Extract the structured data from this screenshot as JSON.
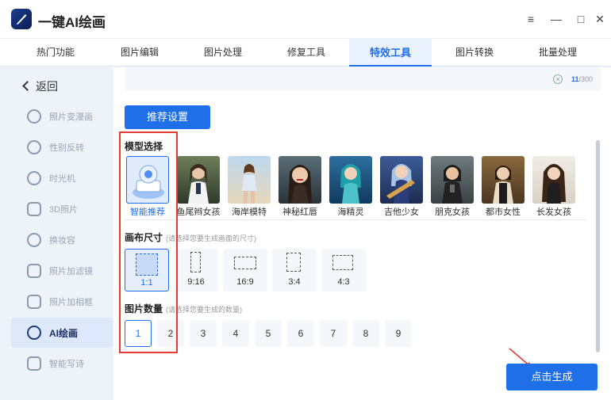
{
  "app": {
    "title": "一键AI绘画"
  },
  "window_controls": {
    "menu": "≡",
    "minimize": "—",
    "maximize": "□",
    "close": "✕"
  },
  "tabs": [
    {
      "label": "热门功能",
      "active": false
    },
    {
      "label": "图片编辑",
      "active": false
    },
    {
      "label": "图片处理",
      "active": false
    },
    {
      "label": "修复工具",
      "active": false
    },
    {
      "label": "特效工具",
      "active": true
    },
    {
      "label": "图片转换",
      "active": false
    },
    {
      "label": "批量处理",
      "active": false
    }
  ],
  "sidebar": {
    "back_label": "返回",
    "items": [
      {
        "label": "照片变漫画",
        "icon": "cartoon-face-icon"
      },
      {
        "label": "性别反转",
        "icon": "gender-icon"
      },
      {
        "label": "时光机",
        "icon": "clock-icon"
      },
      {
        "label": "3D照片",
        "icon": "layers-icon"
      },
      {
        "label": "换妆容",
        "icon": "makeup-icon"
      },
      {
        "label": "照片加滤镜",
        "icon": "filter-icon"
      },
      {
        "label": "照片加相框",
        "icon": "frame-icon"
      },
      {
        "label": "AI绘画",
        "icon": "ai-paint-icon",
        "active": true
      },
      {
        "label": "智能写诗",
        "icon": "ai-poem-icon"
      }
    ]
  },
  "prompt": {
    "counter_current": "11",
    "counter_max": "/300"
  },
  "recommend_button": "推荐设置",
  "model_section": {
    "title": "模型选择",
    "models": [
      {
        "label": "智能推荐",
        "active": true
      },
      {
        "label": "鱼尾辫女孩"
      },
      {
        "label": "海岸模特"
      },
      {
        "label": "神秘红唇"
      },
      {
        "label": "海精灵"
      },
      {
        "label": "吉他少女"
      },
      {
        "label": "朋克女孩"
      },
      {
        "label": "都市女性"
      },
      {
        "label": "长发女孩"
      }
    ]
  },
  "canvas_section": {
    "title": "画布尺寸",
    "hint": "(请选择您要生成画面的尺寸)",
    "ratios": [
      {
        "label": "1:1",
        "active": true
      },
      {
        "label": "9:16"
      },
      {
        "label": "16:9"
      },
      {
        "label": "3:4"
      },
      {
        "label": "4:3"
      }
    ]
  },
  "count_section": {
    "title": "图片数量",
    "hint": "(请选择您要生成的数量)",
    "options": [
      "1",
      "2",
      "3",
      "4",
      "5",
      "6",
      "7",
      "8",
      "9"
    ],
    "selected": "1"
  },
  "generate_button": "点击生成",
  "colors": {
    "accent": "#1f6fe8",
    "highlight": "#e53935"
  }
}
